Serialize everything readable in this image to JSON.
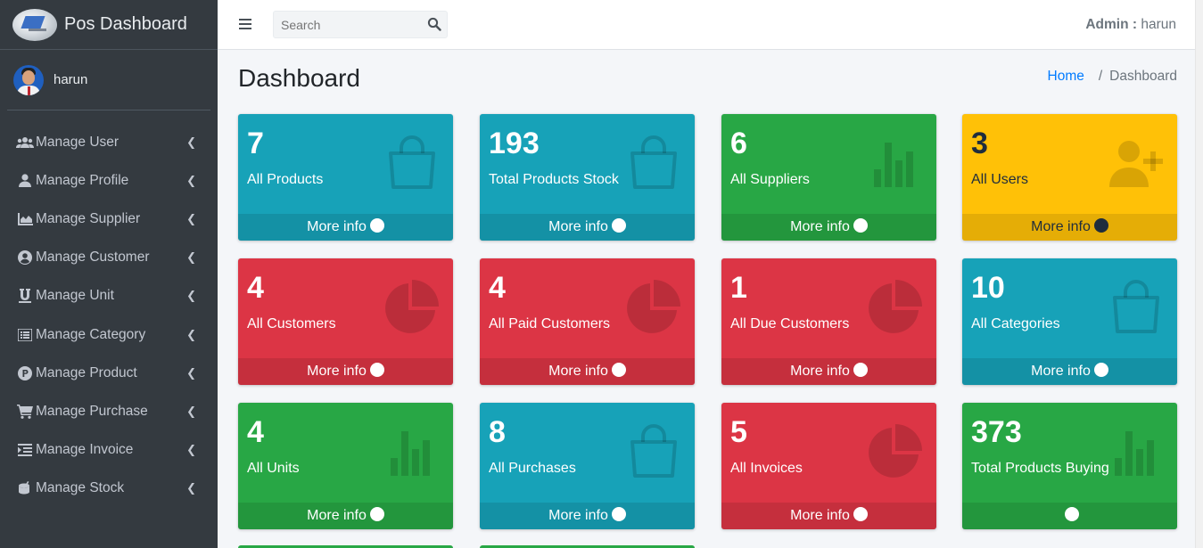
{
  "brand": {
    "name": "Pos Dashboard",
    "logo_icon": "brand-logo-icon"
  },
  "user": {
    "name": "harun"
  },
  "sidebar": {
    "items": [
      {
        "label": "Manage User",
        "icon": "users-icon"
      },
      {
        "label": "Manage Profile",
        "icon": "user-icon"
      },
      {
        "label": "Manage Supplier",
        "icon": "chart-area-icon"
      },
      {
        "label": "Manage Customer",
        "icon": "user-circle-icon"
      },
      {
        "label": "Manage Unit",
        "icon": "underline-icon"
      },
      {
        "label": "Manage Category",
        "icon": "list-icon"
      },
      {
        "label": "Manage Product",
        "icon": "product-hunt-icon"
      },
      {
        "label": "Manage Purchase",
        "icon": "cart-icon"
      },
      {
        "label": "Manage Invoice",
        "icon": "indent-icon"
      },
      {
        "label": "Manage Stock",
        "icon": "drum-icon"
      }
    ]
  },
  "navbar": {
    "search_placeholder": "Search",
    "admin_label": "Admin :",
    "admin_name": "harun"
  },
  "content": {
    "title": "Dashboard",
    "breadcrumb": {
      "home": "Home",
      "sep": "/",
      "current": "Dashboard"
    }
  },
  "boxes": [
    {
      "value": "7",
      "label": "All Products",
      "color": "info",
      "icon": "shopping-bag-icon",
      "more": "More info"
    },
    {
      "value": "193",
      "label": "Total Products Stock",
      "color": "info",
      "icon": "shopping-bag-icon",
      "more": "More info"
    },
    {
      "value": "6",
      "label": "All Suppliers",
      "color": "success",
      "icon": "bar-chart-icon",
      "more": "More info"
    },
    {
      "value": "3",
      "label": "All Users",
      "color": "warning",
      "icon": "user-plus-icon",
      "more": "More info"
    },
    {
      "value": "4",
      "label": "All Customers",
      "color": "danger",
      "icon": "pie-chart-icon",
      "more": "More info"
    },
    {
      "value": "4",
      "label": "All Paid Customers",
      "color": "danger",
      "icon": "pie-chart-icon",
      "more": "More info"
    },
    {
      "value": "1",
      "label": "All Due Customers",
      "color": "danger",
      "icon": "pie-chart-icon",
      "more": "More info"
    },
    {
      "value": "10",
      "label": "All Categories",
      "color": "info",
      "icon": "shopping-bag-icon",
      "more": "More info"
    },
    {
      "value": "4",
      "label": "All Units",
      "color": "success",
      "icon": "bar-chart-icon",
      "more": "More info"
    },
    {
      "value": "8",
      "label": "All Purchases",
      "color": "info",
      "icon": "shopping-bag-icon",
      "more": "More info"
    },
    {
      "value": "5",
      "label": "All Invoices",
      "color": "danger",
      "icon": "pie-chart-icon",
      "more": "More info"
    },
    {
      "value": "373",
      "label": "Total Products Buying",
      "color": "success",
      "icon": "bar-chart-icon",
      "more": ""
    }
  ],
  "colors": {
    "info": "#17a2b8",
    "success": "#28a745",
    "warning": "#ffc107",
    "danger": "#dc3545",
    "sidebar": "#343a40"
  }
}
